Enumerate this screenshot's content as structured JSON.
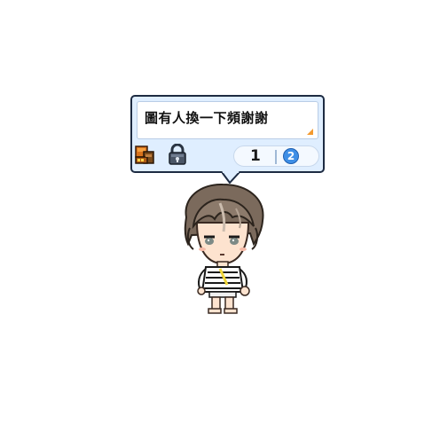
{
  "chat_balloon": {
    "message": "圖有人換一下頻謝謝",
    "page_current": "1",
    "page_total": "2"
  },
  "icons": {
    "box": "treasure-box-icon",
    "lock": "padlock-icon",
    "corner": "expand-corner-icon"
  },
  "colors": {
    "balloon_bg": "#dfeeff",
    "balloon_border": "#1d2b42",
    "accent_orange": "#f39a2f",
    "page_button_blue": "#3f8fe6"
  }
}
